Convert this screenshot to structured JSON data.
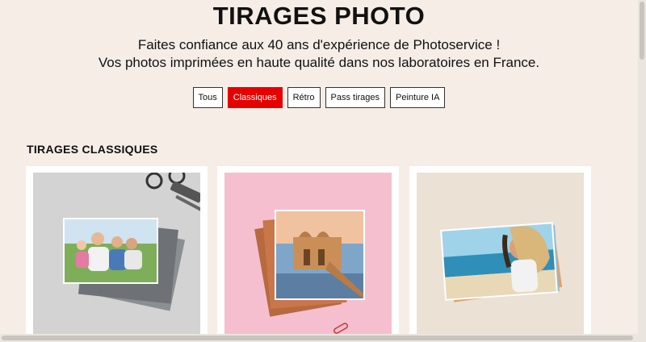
{
  "header": {
    "title": "TIRAGES PHOTO",
    "subtitle_line1": "Faites confiance aux 40 ans d'expérience de Photoservice !",
    "subtitle_line2": "Vos photos imprimées en haute qualité dans nos laboratoires en France."
  },
  "filters": [
    {
      "label": "Tous",
      "active": false
    },
    {
      "label": "Classiques",
      "active": true
    },
    {
      "label": "Rétro",
      "active": false
    },
    {
      "label": "Pass tirages",
      "active": false
    },
    {
      "label": "Peinture IA",
      "active": false
    }
  ],
  "section": {
    "title": "TIRAGES CLASSIQUES"
  },
  "colors": {
    "accent": "#e60000",
    "background": "#f5ede6"
  },
  "cards": [
    {
      "image": "family-photo-prints-stack"
    },
    {
      "image": "palace-photo-prints-stack"
    },
    {
      "image": "beach-woman-photo-prints-stack"
    }
  ]
}
